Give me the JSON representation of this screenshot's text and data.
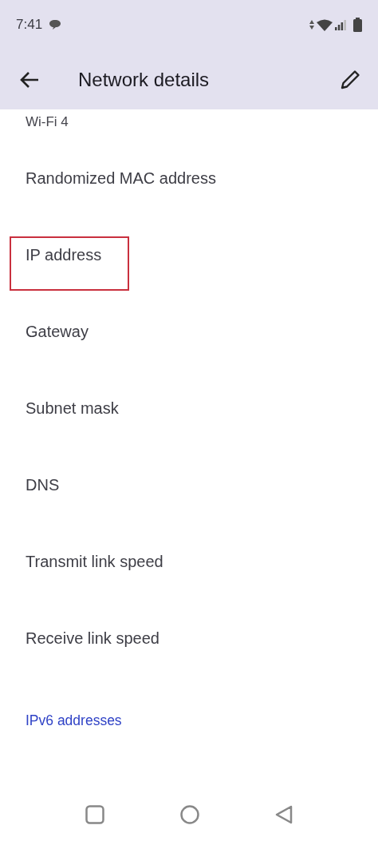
{
  "status_bar": {
    "time": "7:41"
  },
  "app_bar": {
    "title": "Network details"
  },
  "partial_value": "Wi-Fi 4",
  "items": [
    {
      "label": "Randomized MAC address",
      "highlighted": false
    },
    {
      "label": "IP address",
      "highlighted": true
    },
    {
      "label": "Gateway",
      "highlighted": false
    },
    {
      "label": "Subnet mask",
      "highlighted": false
    },
    {
      "label": "DNS",
      "highlighted": false
    },
    {
      "label": "Transmit link speed",
      "highlighted": false
    },
    {
      "label": "Receive link speed",
      "highlighted": false
    }
  ],
  "section_header": "IPv6 addresses"
}
